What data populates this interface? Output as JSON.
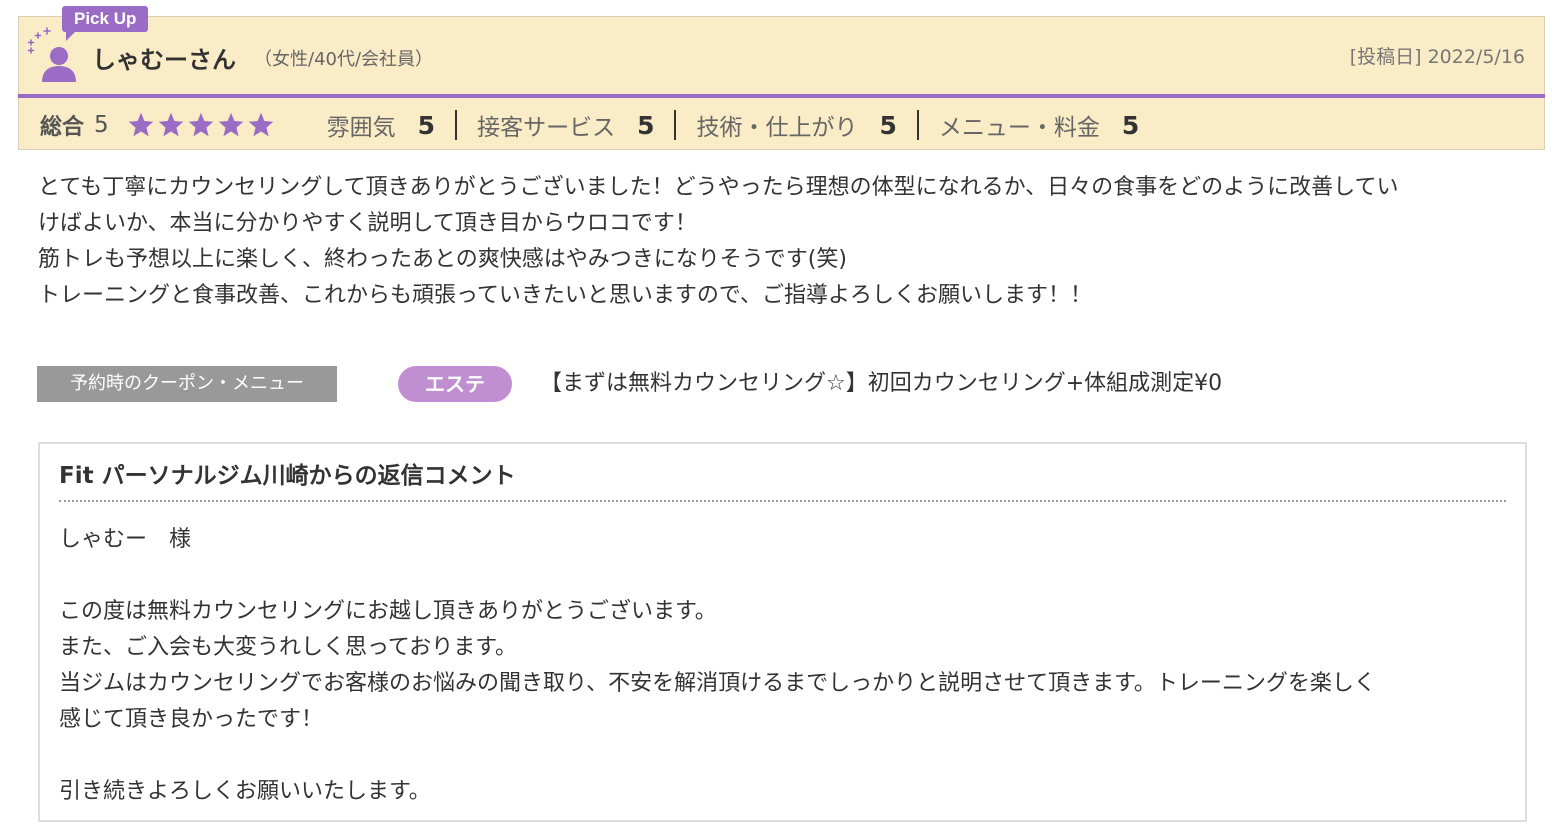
{
  "review": {
    "pickup_label": "Pick Up",
    "reviewer_name": "しゃむーさん",
    "reviewer_attrs": "（女性/40代/会社員）",
    "post_date": "[投稿日] 2022/5/16",
    "overall_label": "総合",
    "overall_score": "5",
    "stars_filled": 5,
    "stars_total": 5,
    "ratings": [
      {
        "label": "雰囲気",
        "value": "5"
      },
      {
        "label": "接客サービス",
        "value": "5"
      },
      {
        "label": "技術・仕上がり",
        "value": "5"
      },
      {
        "label": "メニュー・料金",
        "value": "5"
      }
    ],
    "body_lines": [
      "とても丁寧にカウンセリングして頂きありがとうございました！どうやったら理想の体型になれるか、日々の食事をどのように改善してい",
      "けばよいか、本当に分かりやすく説明して頂き目からウロコです！",
      "筋トレも予想以上に楽しく、終わったあとの爽快感はやみつきになりそうです(笑)",
      "トレーニングと食事改善、これからも頑張っていきたいと思いますので、ご指導よろしくお願いします！！"
    ]
  },
  "coupon": {
    "label": "予約時のクーポン・メニュー",
    "category": "エステ",
    "name": "【まずは無料カウンセリング☆】初回カウンセリング+体組成測定¥0"
  },
  "reply": {
    "title": "Fit パーソナルジム川崎からの返信コメント",
    "lines": [
      "しゃむー　様",
      "",
      "この度は無料カウンセリングにお越し頂きありがとうございます。",
      "また、ご入会も大変うれしく思っております。",
      "当ジムはカウンセリングでお客様のお悩みの聞き取り、不安を解消頂けるまでしっかりと説明させて頂きます。トレーニングを楽しく",
      "感じて頂き良かったです！",
      "",
      "引き続きよろしくお願いいたします。"
    ]
  },
  "colors": {
    "accent_purple": "#9a6cc6",
    "header_bg": "#f9ecc6",
    "star": "#9a6cc6",
    "category_pill": "#c08fd2",
    "coupon_label_bg": "#999999"
  },
  "icons": {
    "reviewer": "person-icon",
    "sparkle": "sparkle-icon",
    "star": "star-icon"
  }
}
